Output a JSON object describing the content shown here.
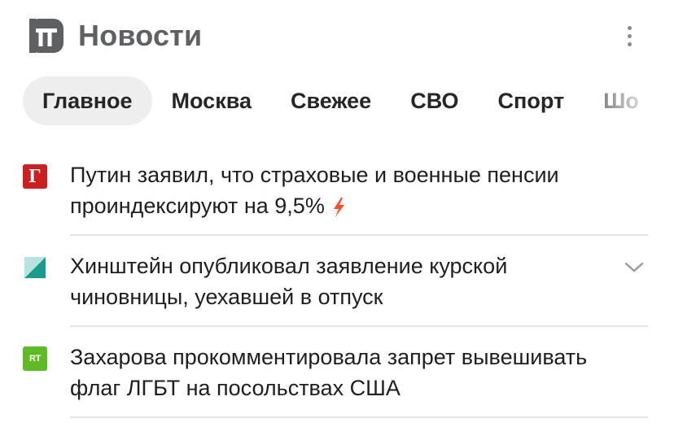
{
  "header": {
    "title": "Новости",
    "logo_icon": "news-logo-icon",
    "more_icon": "more-vertical-icon"
  },
  "tabs": [
    {
      "label": "Главное",
      "active": true
    },
    {
      "label": "Москва",
      "active": false
    },
    {
      "label": "Свежее",
      "active": false
    },
    {
      "label": "СВО",
      "active": false
    },
    {
      "label": "Спорт",
      "active": false
    },
    {
      "label": "Шо",
      "active": false
    }
  ],
  "news": [
    {
      "source_icon": "gazeta-source-icon",
      "source_letter": "Г",
      "text": "Путин заявил, что страховые и военные пенсии проиндексируют на 9,5%",
      "flash_icon": "lightning-icon"
    },
    {
      "source_icon": "source-logo-icon",
      "text": "Хинштейн опубликовал заявление курской чиновницы, уехавшей в отпуск",
      "expand_icon": "chevron-down-icon"
    },
    {
      "source_icon": "rt-source-icon",
      "source_letter": "RT",
      "text": "Захарова прокомментировала запрет вывешивать флаг ЛГБТ на посольствах США"
    }
  ],
  "colors": {
    "title": "#5f6062",
    "active_tab_bg": "#eeeeee",
    "flash": "#ff4f2e",
    "gazeta": "#cc1f1f",
    "rt": "#5fbb25"
  }
}
